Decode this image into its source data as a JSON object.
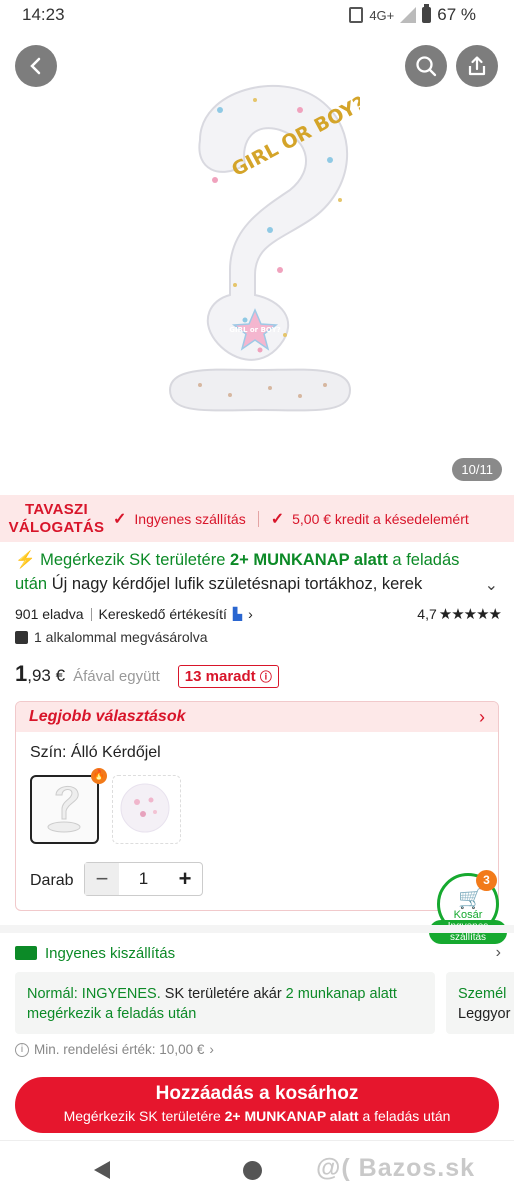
{
  "status_bar": {
    "time": "14:23",
    "network": "4G+",
    "battery": "67 %"
  },
  "gallery": {
    "counter": "10/11",
    "image_texts": [
      "GIRL OR BOY?",
      "GIRL or BOY?"
    ]
  },
  "promo": {
    "title_line1": "TAVASZI",
    "title_line2": "VÁLOGATÁS",
    "item1": "Ingyenes szállítás",
    "item2": "5,00 € kredit a késedelemért"
  },
  "product": {
    "shipping_highlight_1": "Megérkezik SK területére ",
    "shipping_highlight_2": "2+ MUNKANAP alatt",
    "shipping_highlight_3": "  a feladás után",
    "title": " Új nagy kérdőjel lufik születésnapi tortákhoz, kerek",
    "sold": "901 eladva",
    "seller_rating_label": "Kereskedő értékesítí",
    "rating": "4,7",
    "stars": "★★★★★",
    "bought": "1 alkalommal megvásárolva",
    "price_int": "1",
    "price_dec": ",93 €",
    "vat": "Áfával együtt",
    "stock": "13 maradt"
  },
  "best_choices": {
    "title": "Legjobb választások",
    "color_label": "Szín: Álló Kérdőjel",
    "qty_label": "Darab",
    "qty_value": "1"
  },
  "cart": {
    "count": "3",
    "label": "Kosár",
    "tag_line1": "Ingyenes",
    "tag_line2": "szállítás"
  },
  "shipping": {
    "title": "Ingyenes kiszállítás",
    "box1_normal": "Normál: INGYENES.",
    "box1_text": " SK területére akár ",
    "box1_green": "2 munkanap alatt",
    "box1_line2": "megérkezik a feladás után",
    "box2_line1": "Személ",
    "box2_line2": "Leggyor",
    "min_order": "Min. rendelési érték: 10,00 €"
  },
  "add_to_cart": {
    "label": "Hozzáadás a kosárhoz",
    "sub_1": "Megérkezik SK területére ",
    "sub_2": "2+ MUNKANAP alatt",
    "sub_3": " a feladás után"
  },
  "watermark": "@( Bazos.sk"
}
